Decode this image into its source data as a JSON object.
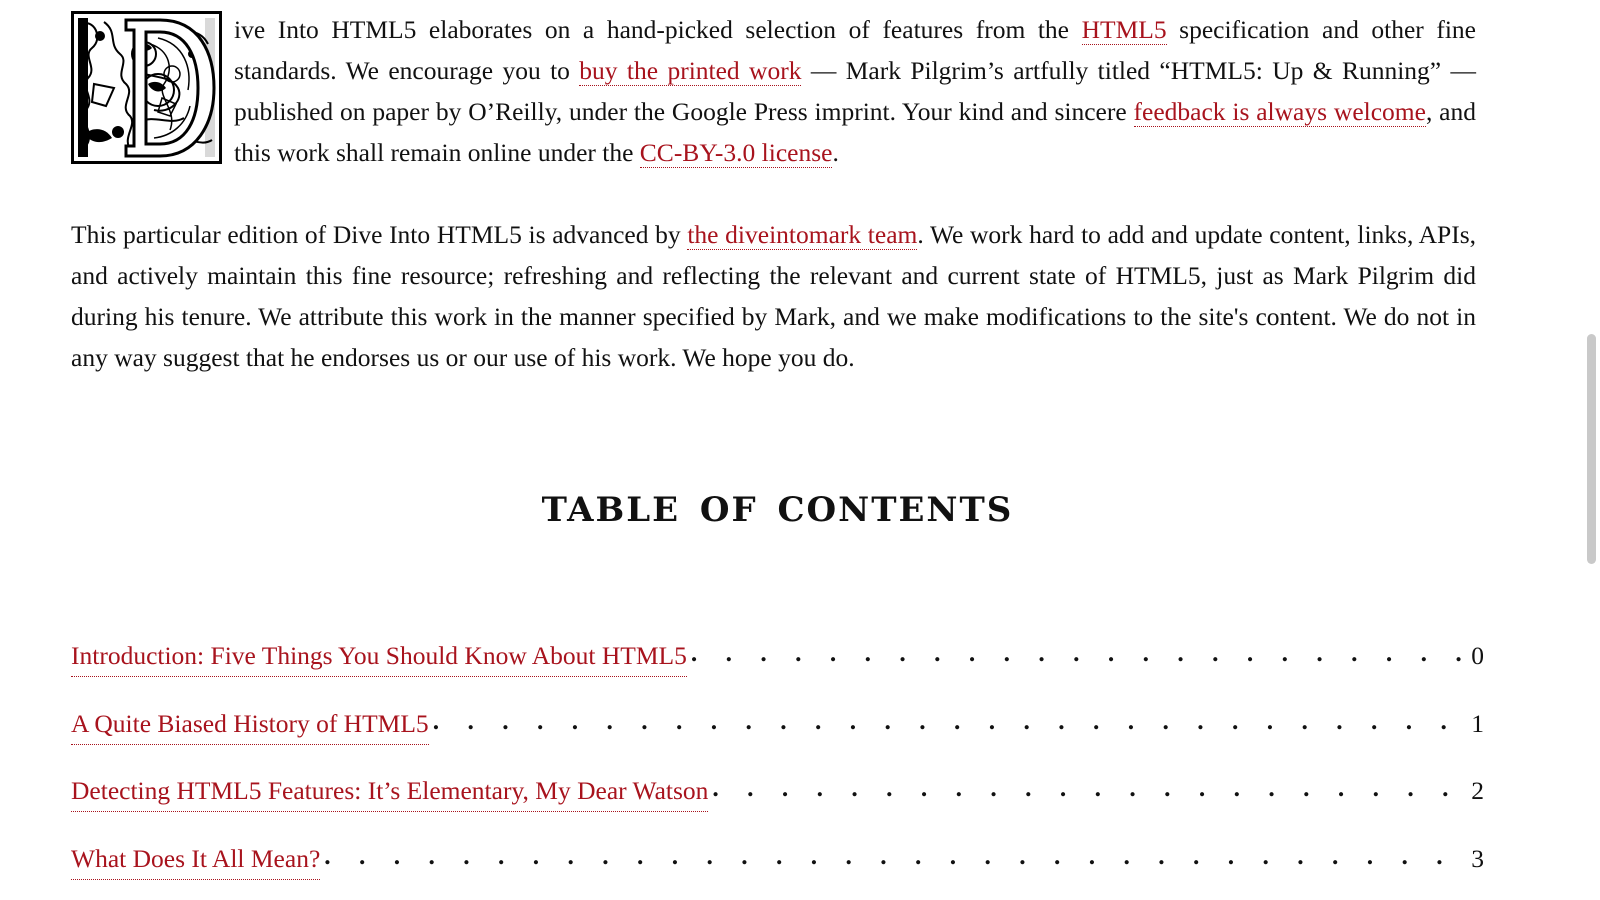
{
  "intro": {
    "dropcap_letter": "D",
    "text_1": "ive Into HTML5 elaborates on a hand-picked selection of features from the ",
    "link_html5": "HTML5",
    "text_2": " specification and other fine standards. We encourage you to ",
    "link_buy": "buy the printed work",
    "text_3": " — Mark Pilgrim’s artfully titled “HTML5: Up & Running” — published on paper by O’Reilly, under the Google Press imprint. Your kind and sincere ",
    "link_feedback": "feedback is always welcome",
    "text_4": ", and this work shall remain online under the ",
    "link_license": "CC-BY-3.0 license",
    "text_5": "."
  },
  "edition": {
    "text_1": "This particular edition of Dive Into HTML5 is advanced by ",
    "link_team": "the diveintomark team",
    "text_2": ". We work hard to add and update content, links, APIs, and actively maintain this fine resource; refreshing and reflecting the relevant and current state of HTML5, just as Mark Pilgrim did during his tenure. We attribute this work in the manner specified by Mark, and we make modifications to the site's content. We do not in any way suggest that he endorses us or our use of his work. We hope you do."
  },
  "toc": {
    "heading": "TABLE OF CONTENTS",
    "items": [
      {
        "title": "Introduction: Five Things You Should Know About HTML5",
        "number": "0"
      },
      {
        "title": "A Quite Biased History of HTML5",
        "number": "1"
      },
      {
        "title": "Detecting HTML5 Features: It’s Elementary, My Dear Watson",
        "number": "2"
      },
      {
        "title": "What Does It All Mean?",
        "number": "3"
      }
    ]
  },
  "colors": {
    "link": "#a8131d",
    "text": "#111111",
    "background": "#ffffff"
  }
}
